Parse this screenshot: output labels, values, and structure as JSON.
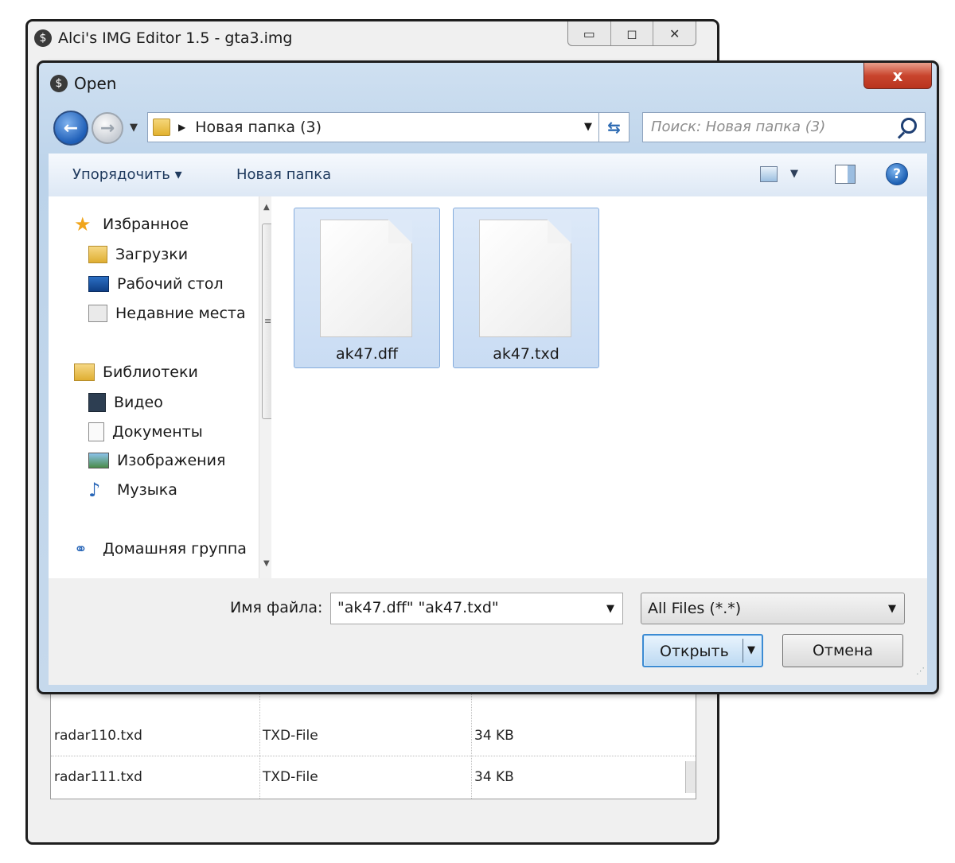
{
  "main_window": {
    "title": "Alci's IMG Editor 1.5 - gta3.img",
    "controls": {
      "minimize": "▭",
      "maximize": "◻",
      "close": "✕"
    },
    "rows": [
      {
        "name": "radar110.txd",
        "type": "TXD-File",
        "size": "34 KB"
      },
      {
        "name": "radar111.txd",
        "type": "TXD-File",
        "size": "34 KB"
      }
    ]
  },
  "dialog": {
    "title": "Open",
    "close_label": "x",
    "address": {
      "path": "Новая папка (3)"
    },
    "search": {
      "placeholder": "Поиск: Новая папка (3)"
    },
    "toolbar": {
      "organize": "Упорядочить ▾",
      "new_folder": "Новая папка"
    },
    "nav": {
      "favorites": {
        "label": "Избранное",
        "items": [
          "Загрузки",
          "Рабочий стол",
          "Недавние места"
        ]
      },
      "libraries": {
        "label": "Библиотеки",
        "items": [
          "Видео",
          "Документы",
          "Изображения",
          "Музыка"
        ]
      },
      "homegroup": {
        "label": "Домашняя группа"
      }
    },
    "files": [
      {
        "name": "ak47.dff",
        "selected": true
      },
      {
        "name": "ak47.txd",
        "selected": true
      }
    ],
    "footer": {
      "filename_label": "Имя файла:",
      "filename_value": "\"ak47.dff\" \"ak47.txd\"",
      "file_type": "All Files (*.*)",
      "open_label": "Открыть",
      "cancel_label": "Отмена"
    }
  },
  "colors": {
    "accent": "#3c8bd3",
    "selection": "#c9dcf3",
    "close_red": "#c9452e"
  }
}
